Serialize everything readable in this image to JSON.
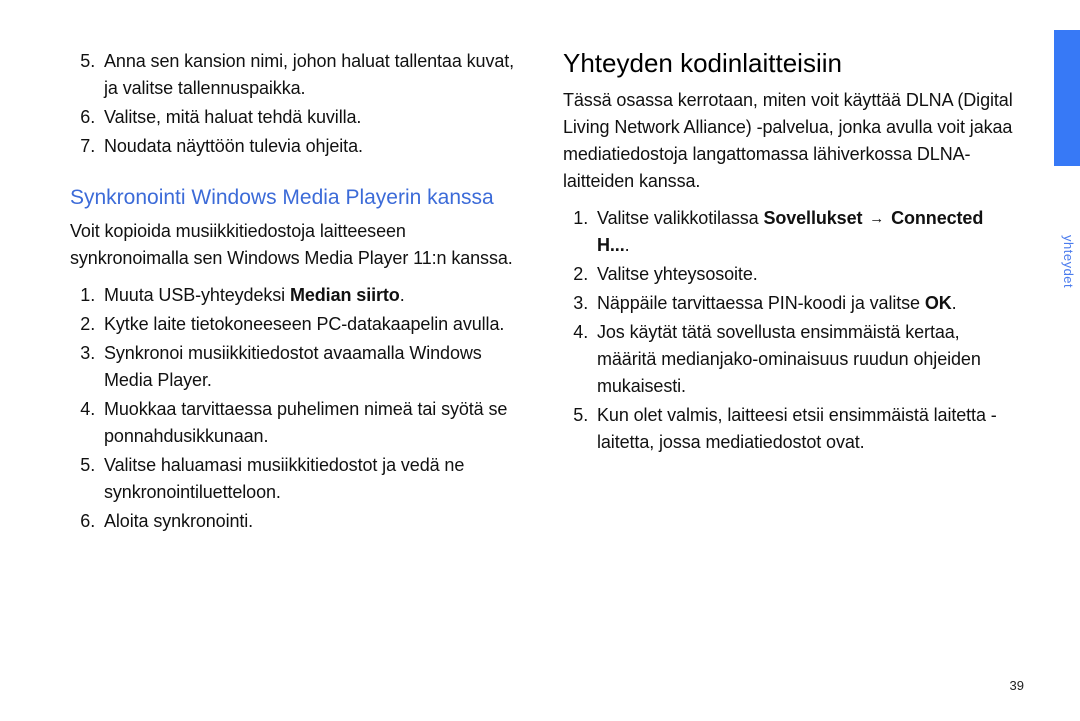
{
  "sidebar": {
    "section_label": "yhteydet"
  },
  "left": {
    "top_list": {
      "start": "5",
      "items": [
        "Anna sen kansion nimi, johon haluat tallentaa kuvat, ja valitse tallennuspaikka.",
        "Valitse, mitä haluat tehdä kuvilla.",
        "Noudata näyttöön tulevia ohjeita."
      ]
    },
    "heading": "Synkronointi Windows Media Playerin kanssa",
    "intro": "Voit kopioida musiikkitiedostoja laitteeseen synkronoimalla sen Windows Media Player 11:n kanssa.",
    "list": {
      "items": [
        {
          "before": "Muuta USB-yhteydeksi ",
          "bold": "Median siirto",
          "after": "."
        },
        {
          "text": "Kytke laite tietokoneeseen PC-datakaapelin avulla."
        },
        {
          "text": "Synkronoi musiikkitiedostot avaamalla Windows Media Player."
        },
        {
          "text": "Muokkaa tarvittaessa puhelimen nimeä tai syötä se ponnahdusikkunaan."
        },
        {
          "text": "Valitse haluamasi musiikkitiedostot ja vedä ne synkronointiluetteloon."
        },
        {
          "text": "Aloita synkronointi."
        }
      ]
    }
  },
  "right": {
    "heading": "Yhteyden kodinlaitteisiin",
    "intro": "Tässä osassa kerrotaan, miten voit käyttää DLNA (Digital Living Network Alliance) -palvelua, jonka avulla voit jakaa mediatiedostoja langattomassa lähiverkossa DLNA-laitteiden kanssa.",
    "list": {
      "items": [
        {
          "before": "Valitse valikkotilassa ",
          "bold1": "Sovellukset",
          "arrow": "→",
          "bold2": "Connected H...",
          "after": "."
        },
        {
          "text": "Valitse yhteysosoite."
        },
        {
          "before": "Näppäile tarvittaessa PIN-koodi ja valitse ",
          "bold1": "OK",
          "after": "."
        },
        {
          "text": "Jos käytät tätä sovellusta ensimmäistä kertaa, määritä medianjako-ominaisuus ruudun ohjeiden mukaisesti."
        },
        {
          "text": "Kun olet valmis, laitteesi etsii ensimmäistä laitetta - laitetta, jossa mediatiedostot ovat."
        }
      ]
    }
  },
  "page_number": "39"
}
